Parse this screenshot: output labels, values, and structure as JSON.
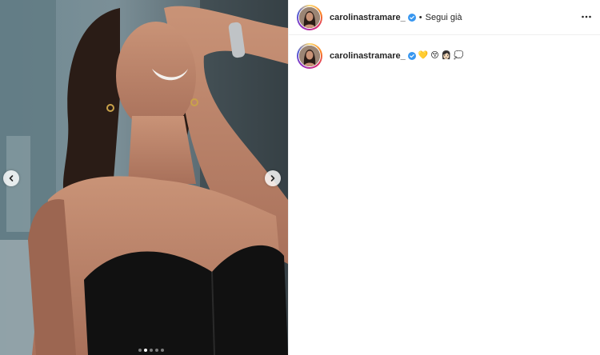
{
  "post": {
    "username": "carolinastramare_",
    "verified": true,
    "separator": "•",
    "follow_label": "Segui già",
    "more_icon": "more-horizontal-icon",
    "caption": {
      "username": "carolinastramare_",
      "emojis": [
        "💛",
        "😚",
        "👩🏻",
        "💭"
      ]
    },
    "carousel": {
      "total_slides": 5,
      "current_slide": 2,
      "prev_icon": "chevron-left-icon",
      "next_icon": "chevron-right-icon"
    },
    "colors": {
      "verified_blue": "#3897f0",
      "text": "#262626",
      "border": "#efefef"
    }
  }
}
